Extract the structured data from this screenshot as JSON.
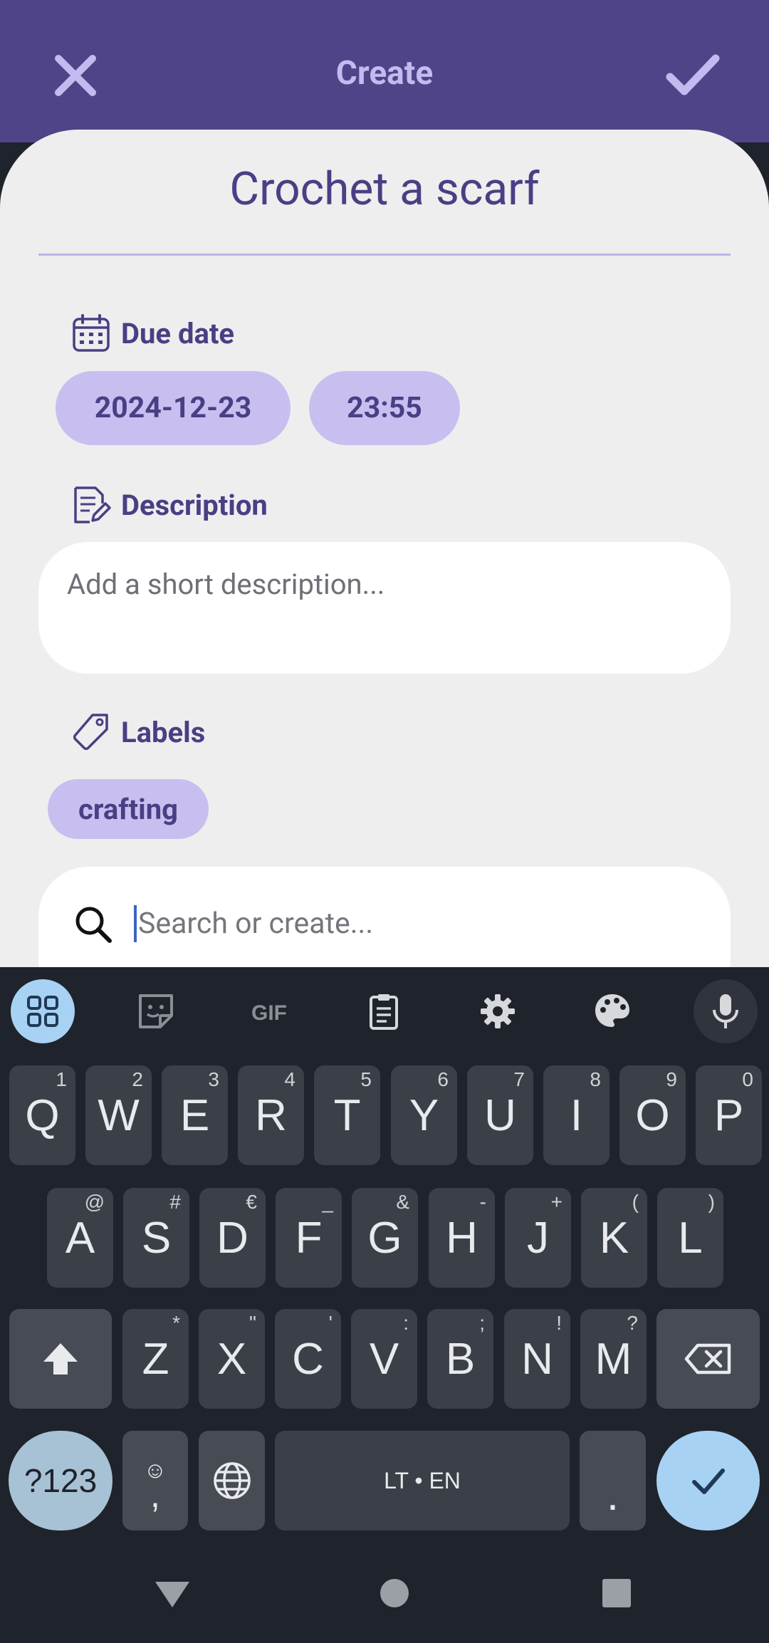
{
  "header": {
    "title": "Create"
  },
  "task": {
    "title": "Crochet a scarf"
  },
  "due_date": {
    "label": "Due date",
    "date": "2024-12-23",
    "time": "23:55"
  },
  "description": {
    "label": "Description",
    "placeholder": "Add a short description..."
  },
  "labels": {
    "label": "Labels",
    "items": [
      "crafting"
    ],
    "search_placeholder": "Search or create..."
  },
  "keyboard": {
    "row1": [
      {
        "k": "Q",
        "s": "1"
      },
      {
        "k": "W",
        "s": "2"
      },
      {
        "k": "E",
        "s": "3"
      },
      {
        "k": "R",
        "s": "4"
      },
      {
        "k": "T",
        "s": "5"
      },
      {
        "k": "Y",
        "s": "6"
      },
      {
        "k": "U",
        "s": "7"
      },
      {
        "k": "I",
        "s": "8"
      },
      {
        "k": "O",
        "s": "9"
      },
      {
        "k": "P",
        "s": "0"
      }
    ],
    "row2": [
      {
        "k": "A",
        "s": "@"
      },
      {
        "k": "S",
        "s": "#"
      },
      {
        "k": "D",
        "s": "€"
      },
      {
        "k": "F",
        "s": "_"
      },
      {
        "k": "G",
        "s": "&"
      },
      {
        "k": "H",
        "s": "-"
      },
      {
        "k": "J",
        "s": "+"
      },
      {
        "k": "K",
        "s": "("
      },
      {
        "k": "L",
        "s": ")"
      }
    ],
    "row3": [
      {
        "k": "Z",
        "s": "*"
      },
      {
        "k": "X",
        "s": "\""
      },
      {
        "k": "C",
        "s": "'"
      },
      {
        "k": "V",
        "s": ":"
      },
      {
        "k": "B",
        "s": ";"
      },
      {
        "k": "N",
        "s": "!"
      },
      {
        "k": "M",
        "s": "?"
      }
    ],
    "symbols_label": "?123",
    "comma_label": ",",
    "emoji_label": "☺",
    "space_label": "LT • EN",
    "period_label": "."
  },
  "colors": {
    "header_bg": "#4f4488",
    "accent": "#4a3f84",
    "chip": "#c8bff0",
    "keyboard_bg": "#1f232b",
    "enter_key": "#a8d2f3"
  }
}
